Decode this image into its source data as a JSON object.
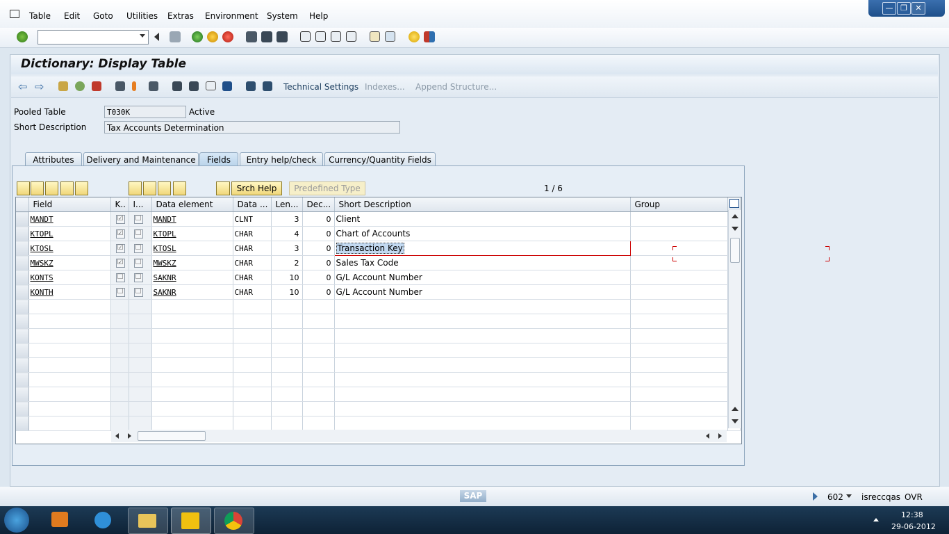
{
  "menu": [
    "Table",
    "Edit",
    "Goto",
    "Utilities",
    "Extras",
    "Environment",
    "System",
    "Help"
  ],
  "window_controls": {
    "minimize": "—",
    "restore": "❐",
    "close": "✕"
  },
  "command_field": {
    "value": ""
  },
  "title": "Dictionary: Display Table",
  "app_toolbar": {
    "technical_settings": "Technical Settings",
    "indexes": "Indexes...",
    "append_structure": "Append Structure..."
  },
  "header": {
    "table_type_label": "Pooled Table",
    "table_name": "T030K",
    "status": "Active",
    "short_description_label": "Short Description",
    "short_description": "Tax Accounts Determination"
  },
  "tabs": [
    "Attributes",
    "Delivery and Maintenance",
    "Fields",
    "Entry help/check",
    "Currency/Quantity Fields"
  ],
  "active_tab": "Fields",
  "table_toolbar": {
    "srch_help": "Srch Help",
    "predefined_type": "Predefined Type",
    "pager": "1 / 6"
  },
  "columns": [
    "Field",
    "K..",
    "I...",
    "Data element",
    "Data ...",
    "Len...",
    "Dec...",
    "Short Description",
    "Group"
  ],
  "rows": [
    {
      "field": "MANDT",
      "key": "☑",
      "init": "☐",
      "data_element": "MANDT",
      "data_type": "CLNT",
      "length": "3",
      "decimals": "0",
      "short_description": "Client",
      "group": ""
    },
    {
      "field": "KTOPL",
      "key": "☑",
      "init": "☐",
      "data_element": "KTOPL",
      "data_type": "CHAR",
      "length": "4",
      "decimals": "0",
      "short_description": "Chart of Accounts",
      "group": ""
    },
    {
      "field": "KTOSL",
      "key": "☑",
      "init": "☐",
      "data_element": "KTOSL",
      "data_type": "CHAR",
      "length": "3",
      "decimals": "0",
      "short_description": "Transaction Key",
      "group": ""
    },
    {
      "field": "MWSKZ",
      "key": "☑",
      "init": "☐",
      "data_element": "MWSKZ",
      "data_type": "CHAR",
      "length": "2",
      "decimals": "0",
      "short_description": "Sales Tax Code",
      "group": ""
    },
    {
      "field": "KONTS",
      "key": "☐",
      "init": "☐",
      "data_element": "SAKNR",
      "data_type": "CHAR",
      "length": "10",
      "decimals": "0",
      "short_description": "G/L Account Number",
      "group": ""
    },
    {
      "field": "KONTH",
      "key": "☐",
      "init": "☐",
      "data_element": "SAKNR",
      "data_type": "CHAR",
      "length": "10",
      "decimals": "0",
      "short_description": "G/L Account Number",
      "group": ""
    }
  ],
  "status_bar": {
    "logo": "SAP",
    "client": "602",
    "server": "isreccqas",
    "mode": "OVR"
  },
  "taskbar": {
    "time": "12:38",
    "date": "29-06-2012"
  }
}
